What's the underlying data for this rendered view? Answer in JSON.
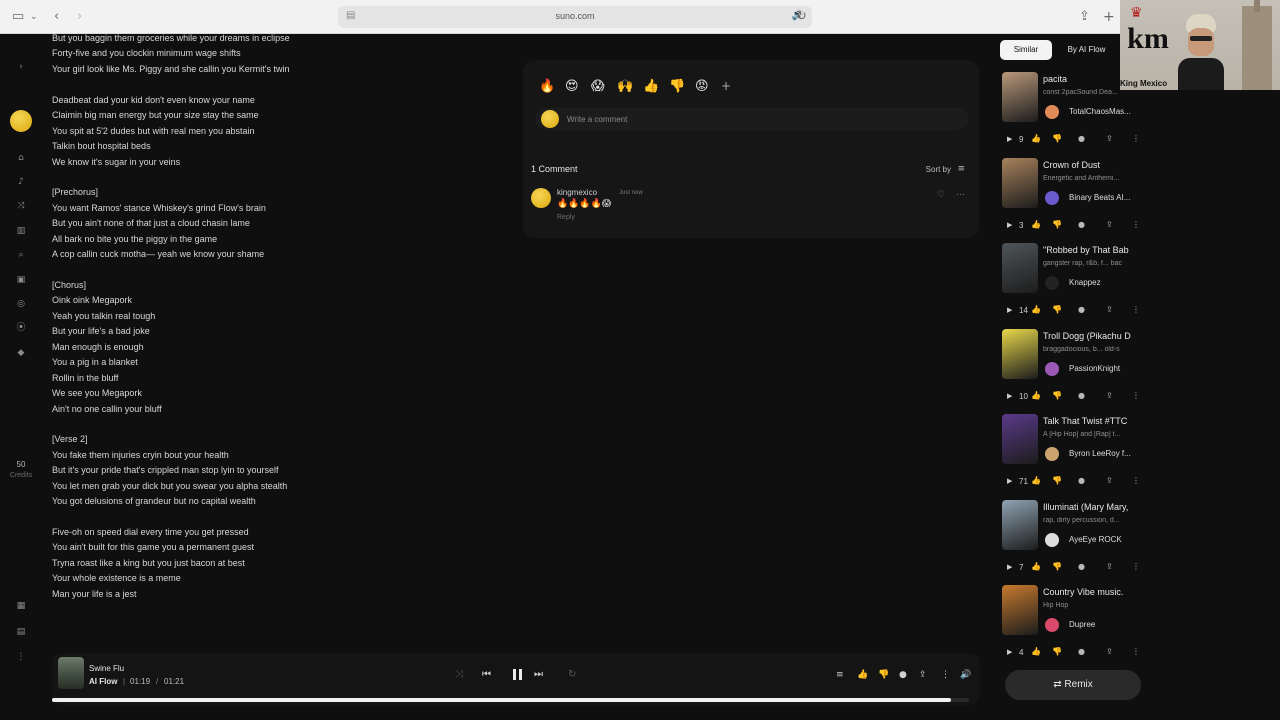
{
  "browser": {
    "url": "suno.com"
  },
  "webcam": {
    "caption": "King Mexico"
  },
  "nav": {
    "credits_count": "50",
    "credits_label": "Credits"
  },
  "lyrics": [
    "But you baggin them groceries while your dreams in eclipse",
    "Forty-five and you clockin minimum wage shifts",
    "Your girl look like Ms. Piggy and she callin you Kermit's twin",
    "",
    "Deadbeat dad your kid don't even know your name",
    "Claimin big man energy but your size stay the same",
    "You spit at 5'2 dudes but with real men you abstain",
    "Talkin bout hospital beds",
    "We know it's sugar in your veins",
    "",
    "[Prechorus]",
    "You want Ramos' stance Whiskey's grind Flow's brain",
    "But you ain't none of that just a cloud chasin lame",
    "All bark no bite you the piggy in the game",
    "A cop callin cuck motha— yeah we know your shame",
    "",
    "[Chorus]",
    "Oink oink Megapork",
    "Yeah you talkin real tough",
    "But your life's a bad joke",
    "Man enough is enough",
    "You a pig in a blanket",
    "Rollin in the bluff",
    "We see you Megapork",
    "Ain't no one callin your bluff",
    "",
    "[Verse 2]",
    "You fake them injuries cryin bout your health",
    "But it's your pride that's crippled man stop lyin to yourself",
    "You let men grab your dick but you swear you alpha stealth",
    "You got delusions of grandeur but no capital wealth",
    "",
    "Five-oh on speed dial every time you get pressed",
    "You ain't built for this game you a permanent guest",
    "Tryna roast like a king but you just bacon at best",
    "Your whole existence is a meme",
    "Man your life is a jest"
  ],
  "comments": {
    "reactions": [
      "🔥",
      "😍",
      "😱",
      "🙌",
      "👍",
      "👎",
      "😡"
    ],
    "add_reaction": "+",
    "placeholder": "Write a comment",
    "count_label": "1 Comment",
    "sort_label": "Sort by",
    "items": [
      {
        "user": "kingmexico",
        "time": "Just now",
        "text": "🔥🔥🔥🔥😱",
        "reply": "Reply"
      }
    ]
  },
  "player": {
    "title": "Swine Flu",
    "artist": "AI Flow",
    "separator": "|",
    "current_time": "01:19",
    "time_separator": "/",
    "duration": "01:21",
    "progress": 0.98
  },
  "right_panel": {
    "tabs": [
      "Similar",
      "By AI Flow"
    ],
    "songs": [
      {
        "title": "pacita",
        "tags": "const 2pacSound Dea...",
        "artist": "TotalChaosMas...",
        "plays": "9",
        "thumb": "#b9987a",
        "avatar": "#e08a55"
      },
      {
        "title": "Crown of Dust",
        "tags": "Energetic and Anthemi...",
        "artist": "Binary Beats AI...",
        "plays": "3",
        "thumb": "#a8825c",
        "avatar": "#6a5acd"
      },
      {
        "title": "\"Robbed by That Bab",
        "tags": "gangster rap, r&b, f... bac",
        "artist": "Knappez",
        "plays": "14",
        "thumb": "#4f5559",
        "avatar": "#222222"
      },
      {
        "title": "Troll Dogg (Pikachu D",
        "tags": "braggadocious, b... old-s",
        "artist": "PassionKnight",
        "plays": "10",
        "thumb": "#e8d84a",
        "avatar": "#9b59b6"
      },
      {
        "title": "Talk That Twist #TTC",
        "tags": "A [Hip Hop] and [Rap] t...",
        "artist": "Byron LeeRoy f...",
        "plays": "71",
        "thumb": "#5a3a8a",
        "avatar": "#c9a36b"
      },
      {
        "title": "Illuminati (Mary Mary,",
        "tags": "rap, dirty percussion, d...",
        "artist": "AyeEye ROCK",
        "plays": "7",
        "thumb": "#8fa3b3",
        "avatar": "#dddddd"
      },
      {
        "title": "Country Vibe music.",
        "tags": "Hip Hop",
        "artist": "Dupree",
        "plays": "4",
        "thumb": "#c77a2e",
        "avatar": "#d94a6a"
      }
    ],
    "remix_label": "Remix"
  }
}
